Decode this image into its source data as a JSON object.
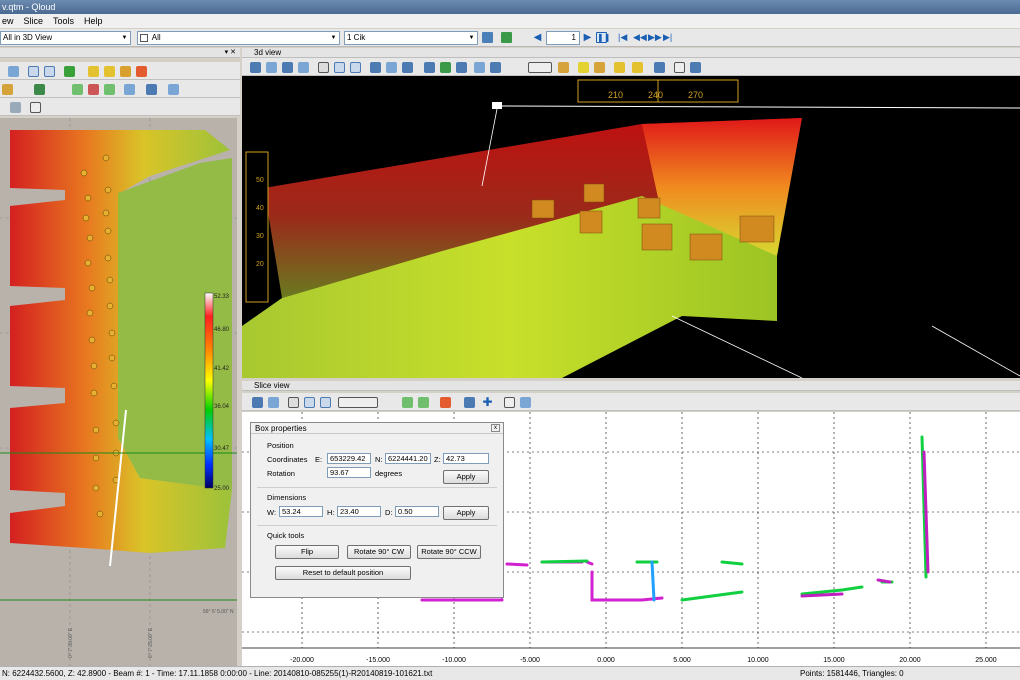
{
  "window": {
    "title": "v.qtm - Qloud"
  },
  "menu": {
    "items": [
      "ew",
      "Slice",
      "Tools",
      "Help"
    ]
  },
  "toolbar": {
    "view_select": "All in 3D View",
    "filter_select": "All",
    "dataset_select": "1 Cik",
    "frame_value": "1"
  },
  "view3d": {
    "title": "3d view",
    "compass_ticks": [
      "210",
      "240",
      "270"
    ],
    "depth_ticks": [
      "50",
      "40",
      "30",
      "20"
    ]
  },
  "colorbar": {
    "labels": [
      "52.33",
      "46.80",
      "41.42",
      "36.04",
      "30.47",
      "25.00"
    ]
  },
  "left_view": {
    "axis_x": "0° 7' 30.00\" E",
    "axis_x2": "6° 7' 25.00\" E",
    "axis_y": "56° 6' 5.00\" N",
    "axis_y2": "56° 6' 4.00\" N"
  },
  "slice_view": {
    "title": "Slice view",
    "x_ticks": [
      "-20.000",
      "-15.000",
      "-10.000",
      "-5.000",
      "0.000",
      "5.000",
      "10.000",
      "15.000",
      "20.000",
      "25.000"
    ]
  },
  "box_properties": {
    "title": "Box properties",
    "close": "x",
    "position_label": "Position",
    "coordinates_label": "Coordinates",
    "e_label": "E:",
    "e_value": "653229.42",
    "n_label": "N:",
    "n_value": "6224441.20",
    "z_label": "Z:",
    "z_value": "42.73",
    "rotation_label": "Rotation",
    "rotation_value": "93.67",
    "degrees_label": "degrees",
    "apply_label": "Apply",
    "dimensions_label": "Dimensions",
    "w_label": "W:",
    "w_value": "53.24",
    "h_label": "H:",
    "h_value": "23.40",
    "d_label": "D:",
    "d_value": "0.50",
    "apply2_label": "Apply",
    "quick_tools_label": "Quick tools",
    "flip_label": "Flip",
    "rotate_cw_label": "Rotate 90° CW",
    "rotate_ccw_label": "Rotate 90° CCW",
    "reset_label": "Reset to default position"
  },
  "status": {
    "left": "N: 6224432.5600, Z: 42.8900 - Beam #: 1 - Time: 17.11.1858 0:00:00 - Line: 20140810-085255(1)-R20140819-101621.txt",
    "right": "Points: 1581446, Triangles: 0"
  }
}
